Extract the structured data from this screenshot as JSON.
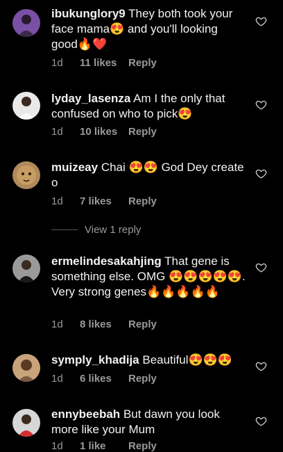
{
  "comments": [
    {
      "username": "ibukunglory9",
      "text": "They both took your face mama😍 and you'll looking good🔥❤️",
      "age": "1d",
      "likes": "11 likes",
      "reply": "Reply"
    },
    {
      "username": "lyday_lasenza",
      "text": "Am I the only that confused on who to pick😍",
      "age": "1d",
      "likes": "10 likes",
      "reply": "Reply"
    },
    {
      "username": "muizeay",
      "text": "Chai 😍😍 God Dey create o",
      "age": "1d",
      "likes": "7 likes",
      "reply": "Reply"
    },
    {
      "username": "ermelindesakahjing",
      "text": "That gene is something else. OMG 😍😍😍😍😍. Very strong genes🔥🔥🔥🔥🔥",
      "age": "1d",
      "likes": "8 likes",
      "reply": "Reply"
    },
    {
      "username": "symply_khadija",
      "text": "Beautiful😍😍😍",
      "age": "1d",
      "likes": "6 likes",
      "reply": "Reply"
    },
    {
      "username": "ennybeebah",
      "text": "But dawn you look more like your Mum",
      "age": "1d",
      "likes": "1 like",
      "reply": "Reply"
    }
  ],
  "view_replies": "View 1 reply",
  "icons": {
    "like": "heart-outline-icon"
  }
}
